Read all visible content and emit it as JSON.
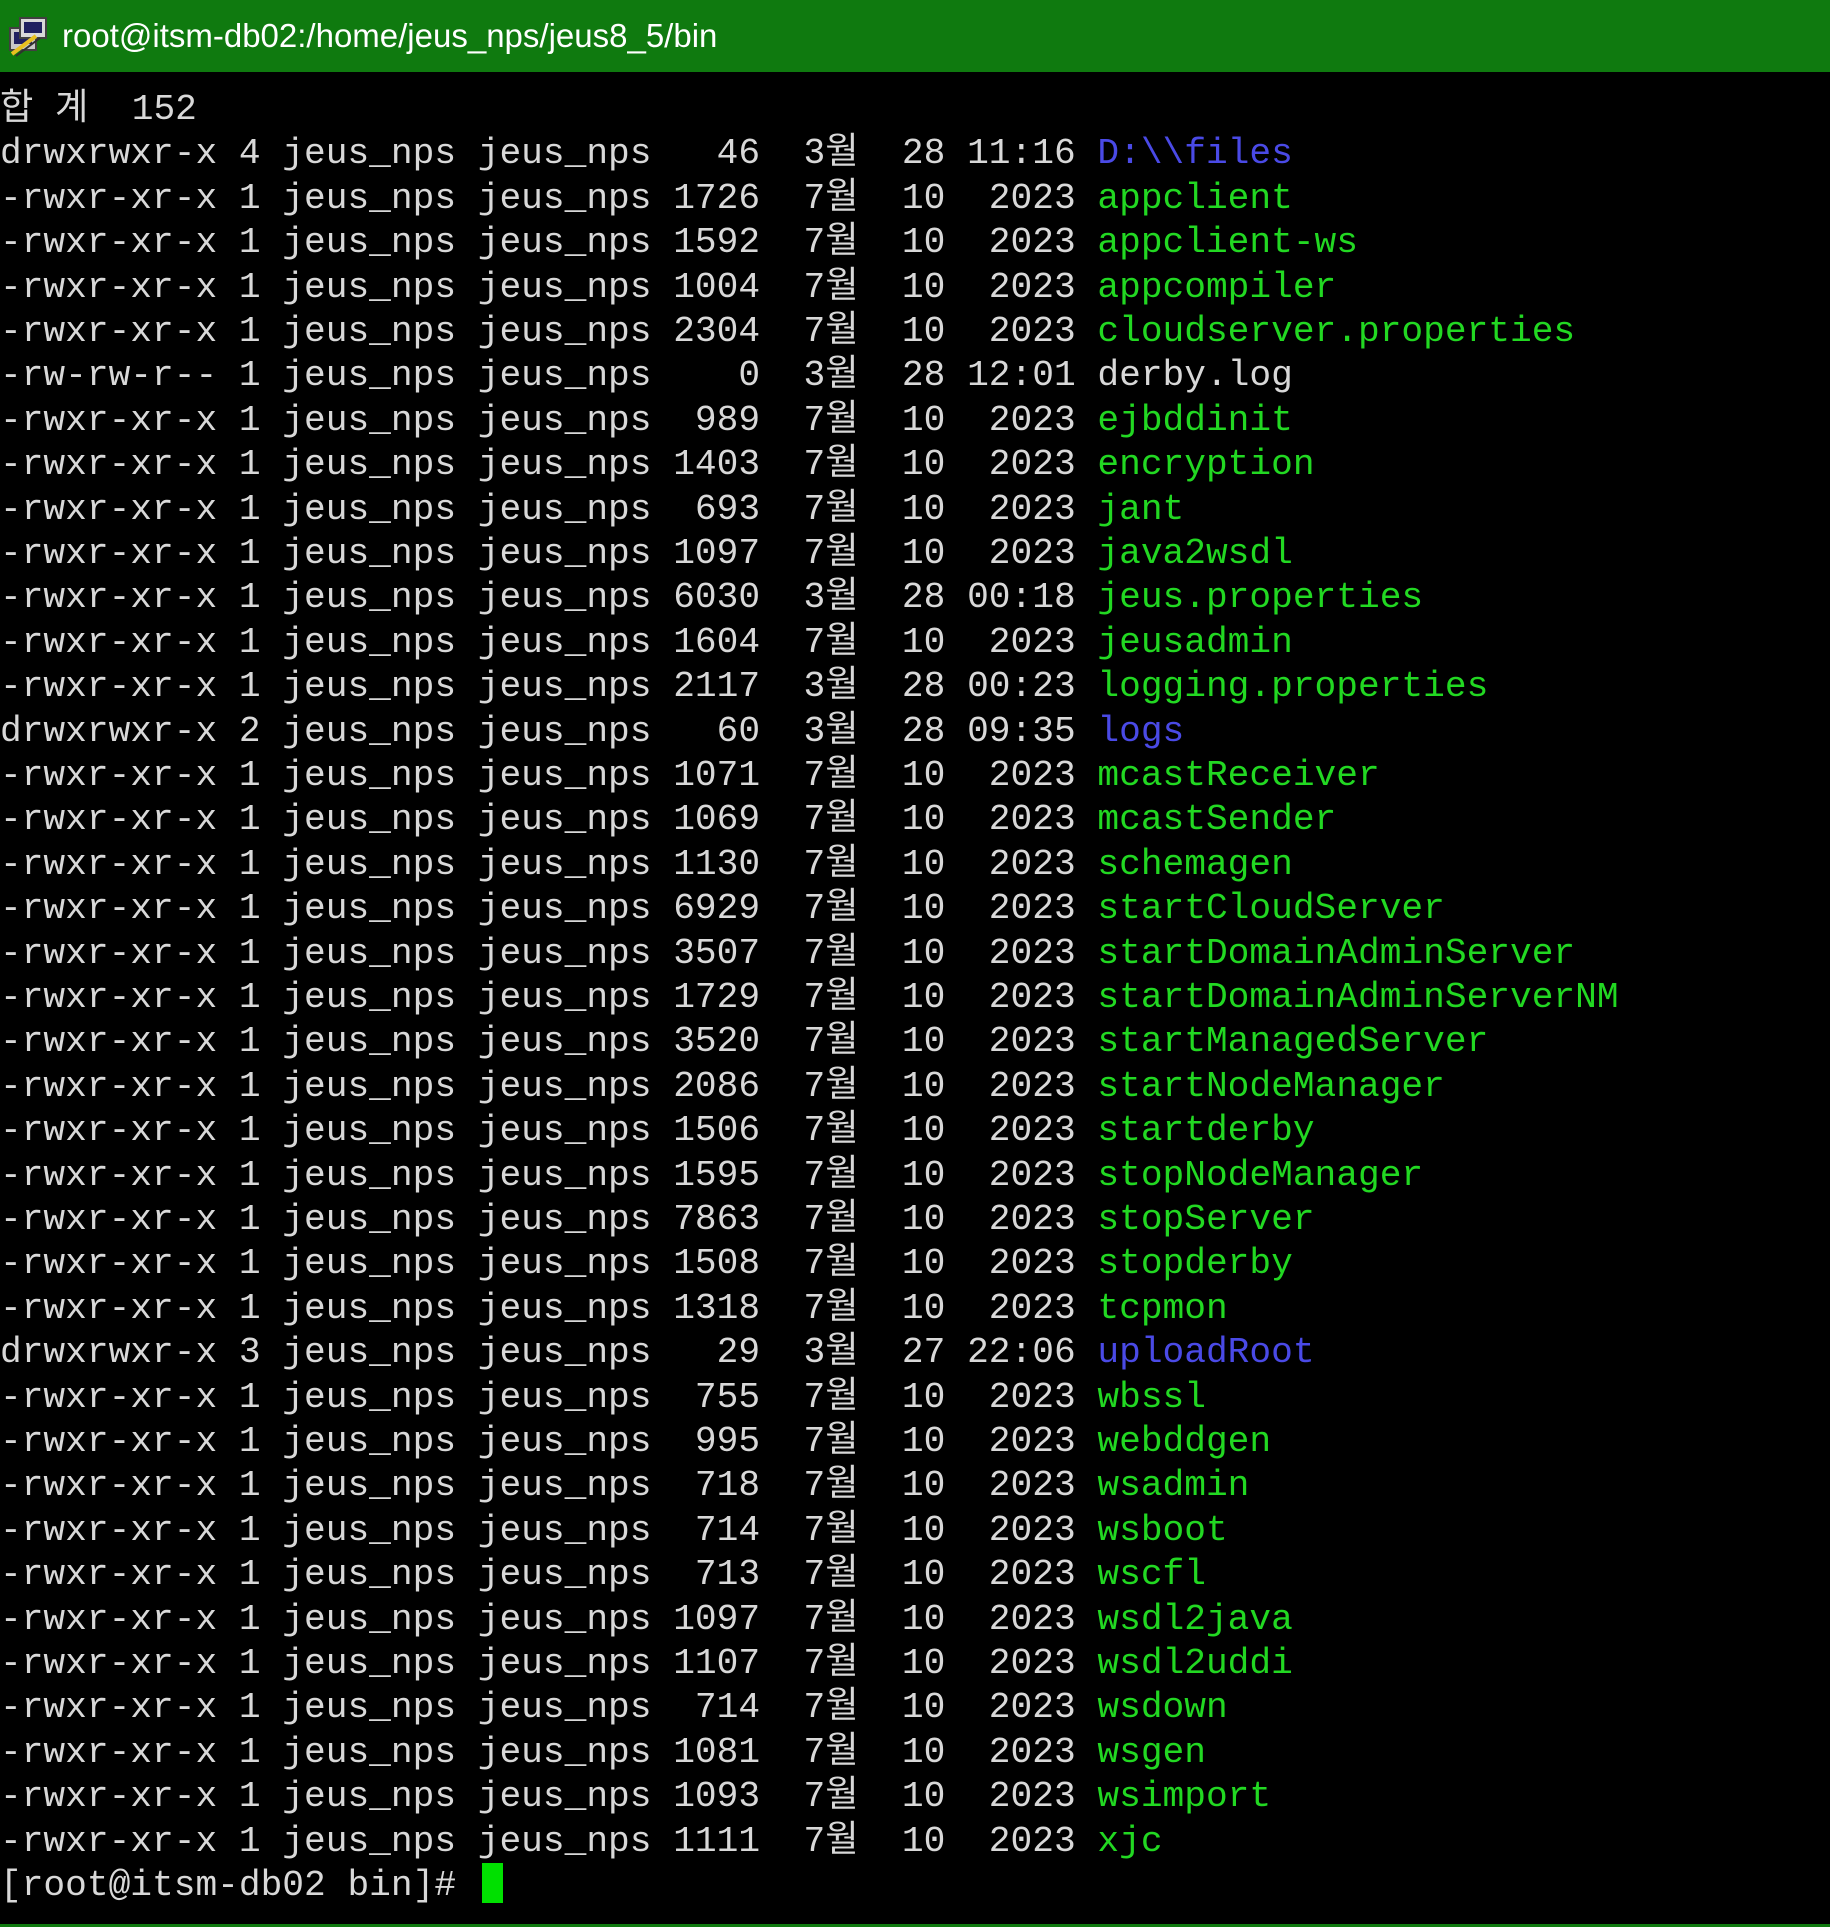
{
  "window": {
    "title": "root@itsm-db02:/home/jeus_nps/jeus8_5/bin",
    "icon": "putty-icon",
    "titlebar_color": "#0f7a0f"
  },
  "terminal": {
    "colors": {
      "background": "#000000",
      "text": "#d8d8d8",
      "executable": "#22d822",
      "directory": "#4a4ae6"
    },
    "total_line": "합 계  152",
    "entries": [
      {
        "meta": "drwxrwxr-x 4 jeus_nps jeus_nps   46  3월  28 11:16 ",
        "name": "D:\\\\files",
        "kind": "dir"
      },
      {
        "meta": "-rwxr-xr-x 1 jeus_nps jeus_nps 1726  7월  10  2023 ",
        "name": "appclient",
        "kind": "exec"
      },
      {
        "meta": "-rwxr-xr-x 1 jeus_nps jeus_nps 1592  7월  10  2023 ",
        "name": "appclient-ws",
        "kind": "exec"
      },
      {
        "meta": "-rwxr-xr-x 1 jeus_nps jeus_nps 1004  7월  10  2023 ",
        "name": "appcompiler",
        "kind": "exec"
      },
      {
        "meta": "-rwxr-xr-x 1 jeus_nps jeus_nps 2304  7월  10  2023 ",
        "name": "cloudserver.properties",
        "kind": "exec"
      },
      {
        "meta": "-rw-rw-r-- 1 jeus_nps jeus_nps    0  3월  28 12:01 ",
        "name": "derby.log",
        "kind": "plain"
      },
      {
        "meta": "-rwxr-xr-x 1 jeus_nps jeus_nps  989  7월  10  2023 ",
        "name": "ejbddinit",
        "kind": "exec"
      },
      {
        "meta": "-rwxr-xr-x 1 jeus_nps jeus_nps 1403  7월  10  2023 ",
        "name": "encryption",
        "kind": "exec"
      },
      {
        "meta": "-rwxr-xr-x 1 jeus_nps jeus_nps  693  7월  10  2023 ",
        "name": "jant",
        "kind": "exec"
      },
      {
        "meta": "-rwxr-xr-x 1 jeus_nps jeus_nps 1097  7월  10  2023 ",
        "name": "java2wsdl",
        "kind": "exec"
      },
      {
        "meta": "-rwxr-xr-x 1 jeus_nps jeus_nps 6030  3월  28 00:18 ",
        "name": "jeus.properties",
        "kind": "exec"
      },
      {
        "meta": "-rwxr-xr-x 1 jeus_nps jeus_nps 1604  7월  10  2023 ",
        "name": "jeusadmin",
        "kind": "exec"
      },
      {
        "meta": "-rwxr-xr-x 1 jeus_nps jeus_nps 2117  3월  28 00:23 ",
        "name": "logging.properties",
        "kind": "exec"
      },
      {
        "meta": "drwxrwxr-x 2 jeus_nps jeus_nps   60  3월  28 09:35 ",
        "name": "logs",
        "kind": "dir"
      },
      {
        "meta": "-rwxr-xr-x 1 jeus_nps jeus_nps 1071  7월  10  2023 ",
        "name": "mcastReceiver",
        "kind": "exec"
      },
      {
        "meta": "-rwxr-xr-x 1 jeus_nps jeus_nps 1069  7월  10  2023 ",
        "name": "mcastSender",
        "kind": "exec"
      },
      {
        "meta": "-rwxr-xr-x 1 jeus_nps jeus_nps 1130  7월  10  2023 ",
        "name": "schemagen",
        "kind": "exec"
      },
      {
        "meta": "-rwxr-xr-x 1 jeus_nps jeus_nps 6929  7월  10  2023 ",
        "name": "startCloudServer",
        "kind": "exec"
      },
      {
        "meta": "-rwxr-xr-x 1 jeus_nps jeus_nps 3507  7월  10  2023 ",
        "name": "startDomainAdminServer",
        "kind": "exec"
      },
      {
        "meta": "-rwxr-xr-x 1 jeus_nps jeus_nps 1729  7월  10  2023 ",
        "name": "startDomainAdminServerNM",
        "kind": "exec"
      },
      {
        "meta": "-rwxr-xr-x 1 jeus_nps jeus_nps 3520  7월  10  2023 ",
        "name": "startManagedServer",
        "kind": "exec"
      },
      {
        "meta": "-rwxr-xr-x 1 jeus_nps jeus_nps 2086  7월  10  2023 ",
        "name": "startNodeManager",
        "kind": "exec"
      },
      {
        "meta": "-rwxr-xr-x 1 jeus_nps jeus_nps 1506  7월  10  2023 ",
        "name": "startderby",
        "kind": "exec"
      },
      {
        "meta": "-rwxr-xr-x 1 jeus_nps jeus_nps 1595  7월  10  2023 ",
        "name": "stopNodeManager",
        "kind": "exec"
      },
      {
        "meta": "-rwxr-xr-x 1 jeus_nps jeus_nps 7863  7월  10  2023 ",
        "name": "stopServer",
        "kind": "exec"
      },
      {
        "meta": "-rwxr-xr-x 1 jeus_nps jeus_nps 1508  7월  10  2023 ",
        "name": "stopderby",
        "kind": "exec"
      },
      {
        "meta": "-rwxr-xr-x 1 jeus_nps jeus_nps 1318  7월  10  2023 ",
        "name": "tcpmon",
        "kind": "exec"
      },
      {
        "meta": "drwxrwxr-x 3 jeus_nps jeus_nps   29  3월  27 22:06 ",
        "name": "uploadRoot",
        "kind": "dir"
      },
      {
        "meta": "-rwxr-xr-x 1 jeus_nps jeus_nps  755  7월  10  2023 ",
        "name": "wbssl",
        "kind": "exec"
      },
      {
        "meta": "-rwxr-xr-x 1 jeus_nps jeus_nps  995  7월  10  2023 ",
        "name": "webddgen",
        "kind": "exec"
      },
      {
        "meta": "-rwxr-xr-x 1 jeus_nps jeus_nps  718  7월  10  2023 ",
        "name": "wsadmin",
        "kind": "exec"
      },
      {
        "meta": "-rwxr-xr-x 1 jeus_nps jeus_nps  714  7월  10  2023 ",
        "name": "wsboot",
        "kind": "exec"
      },
      {
        "meta": "-rwxr-xr-x 1 jeus_nps jeus_nps  713  7월  10  2023 ",
        "name": "wscfl",
        "kind": "exec"
      },
      {
        "meta": "-rwxr-xr-x 1 jeus_nps jeus_nps 1097  7월  10  2023 ",
        "name": "wsdl2java",
        "kind": "exec"
      },
      {
        "meta": "-rwxr-xr-x 1 jeus_nps jeus_nps 1107  7월  10  2023 ",
        "name": "wsdl2uddi",
        "kind": "exec"
      },
      {
        "meta": "-rwxr-xr-x 1 jeus_nps jeus_nps  714  7월  10  2023 ",
        "name": "wsdown",
        "kind": "exec"
      },
      {
        "meta": "-rwxr-xr-x 1 jeus_nps jeus_nps 1081  7월  10  2023 ",
        "name": "wsgen",
        "kind": "exec"
      },
      {
        "meta": "-rwxr-xr-x 1 jeus_nps jeus_nps 1093  7월  10  2023 ",
        "name": "wsimport",
        "kind": "exec"
      },
      {
        "meta": "-rwxr-xr-x 1 jeus_nps jeus_nps 1111  7월  10  2023 ",
        "name": "xjc",
        "kind": "exec"
      }
    ],
    "prompt": "[root@itsm-db02 bin]# "
  }
}
